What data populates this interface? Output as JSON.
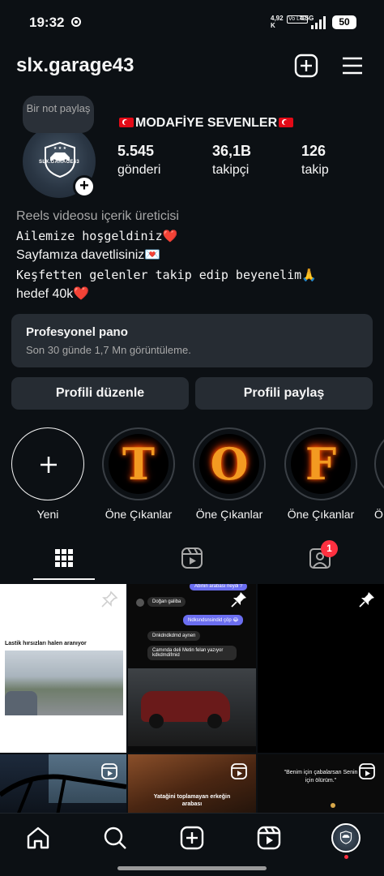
{
  "status_bar": {
    "time": "19:32",
    "net_speed": "4,92\nK",
    "volte": "Vo LTE",
    "network": "4.5G",
    "battery": "50"
  },
  "header": {
    "username": "slx.garage43",
    "icons": [
      "plus-square-icon",
      "menu-icon"
    ]
  },
  "profile": {
    "note": "Bir not paylaş",
    "avatar_text": "SLX.GARAGE43",
    "display_name": "MODAFİYE SEVENLER",
    "stats": [
      {
        "value": "5.545",
        "label": "gönderi"
      },
      {
        "value": "36,1B",
        "label": "takipçi"
      },
      {
        "value": "126",
        "label": "takip"
      }
    ],
    "category": "Reels videosu içerik üreticisi",
    "bio": [
      "Ailemize hoşgeldiniz❤️",
      "Sayfamıza davetlisiniz💌",
      "Keşfetten gelenler takip edip beyenelim🙏",
      "hedef 40k❤️"
    ]
  },
  "dashboard": {
    "title": "Profesyonel pano",
    "subtitle": "Son 30 günde 1,7 Mn görüntüleme."
  },
  "buttons": {
    "edit": "Profili düzenle",
    "share": "Profili paylaş"
  },
  "highlights": [
    {
      "label": "Yeni",
      "letter": ""
    },
    {
      "label": "Öne Çıkanlar",
      "letter": "T"
    },
    {
      "label": "Öne Çıkanlar",
      "letter": "O"
    },
    {
      "label": "Öne Çıkanlar",
      "letter": "F"
    },
    {
      "label": "Ö",
      "letter": ""
    }
  ],
  "tabs": {
    "tagged_badge": "1"
  },
  "posts": {
    "p1_caption": "Lastik hırsızları halen aranıyor",
    "p2_top": "Abinin arabası neydi ?",
    "p2_user": "Doğan galiba",
    "p2_msg1": "Ndksndsnsindid çöp 😂",
    "p2_msg2": "Dnkdndkdmd aynen",
    "p2_msg3": "Camında deli Metin felan yazıyor kdkdmdifmid",
    "p5_caption": "Yatağini toplamayan erkeğin arabası",
    "p6_caption": "\"Benim için çabalarsan Senin için ölürüm.\""
  },
  "colors": {
    "background": "#0c1014",
    "surface": "#262c33",
    "notification": "#ff3040",
    "heart": "#ed2b3a"
  }
}
